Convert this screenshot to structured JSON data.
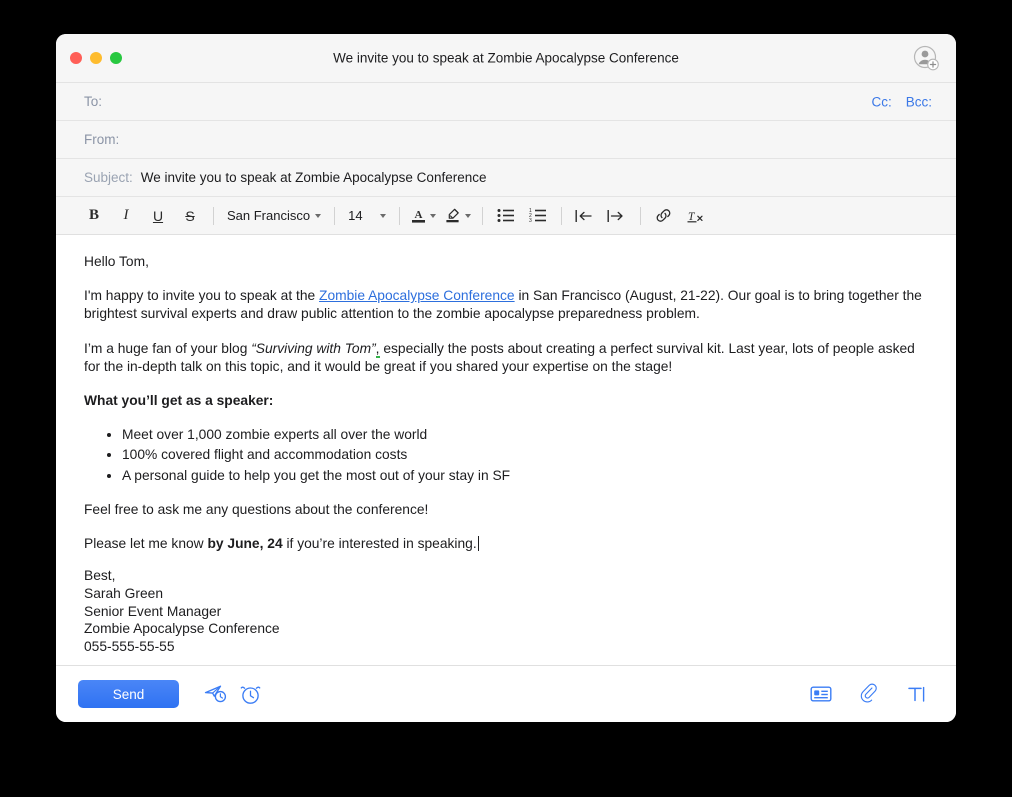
{
  "window": {
    "title": "We invite you to speak at Zombie Apocalypse Conference",
    "traffic_lights": {
      "close": "close-button",
      "minimize": "minimize-button",
      "maximize": "maximize-button"
    },
    "colors": {
      "close": "#ff5f57",
      "minimize": "#febc2e",
      "maximize": "#28c840",
      "accent": "#3b7df5",
      "link": "#2d6fdd",
      "label": "#8b94a6"
    },
    "avatar_icon": "add-contact-icon"
  },
  "fields": {
    "to": {
      "label": "To:",
      "value": "",
      "placeholder": ""
    },
    "from": {
      "label": "From:",
      "value": "",
      "placeholder": ""
    },
    "subject": {
      "label": "Subject:",
      "value": "We invite you to speak at Zombie Apocalypse Conference",
      "placeholder": ""
    },
    "cc_label": "Cc:",
    "bcc_label": "Bcc:"
  },
  "format_toolbar": {
    "bold": "B",
    "italic": "I",
    "underline": "U",
    "strikethrough": "S",
    "font_family": "San Francisco",
    "font_size": "14",
    "text_color_glyph": "A",
    "buttons": [
      "bold-button",
      "italic-button",
      "underline-button",
      "strikethrough-button",
      "font-family-select",
      "font-size-select",
      "text-color-button",
      "highlight-color-button",
      "bullet-list-button",
      "numbered-list-button",
      "outdent-button",
      "indent-button",
      "insert-link-button",
      "clear-formatting-button"
    ]
  },
  "body": {
    "greeting": "Hello Tom,",
    "para1_before_link": "I'm happy to invite you to speak at the ",
    "link_text": "Zombie Apocalypse Conference",
    "para1_after_link": " in San Francisco (August, 21-22). Our goal is to bring together the brightest survival experts and draw public attention to the zombie apocalypse preparedness problem.",
    "para2_before_italic": "I’m a huge fan of your blog ",
    "para2_italic": "“Surviving with Tom”",
    "para2_comma": ",",
    "para2_after_italic": " especially the posts about creating a perfect survival kit. Last year, lots of people asked for the in-depth talk on this topic, and it would be great if you shared your expertise on the stage!",
    "benefits_heading": "What you’ll get as a speaker:",
    "benefits": [
      "Meet over 1,000 zombie experts all over the world",
      "100% covered flight and accommodation costs",
      "A personal guide to help you get the most out of your stay in SF"
    ],
    "para3": "Feel free to ask me any questions about the conference!",
    "para4_before_bold": "Please let me know ",
    "para4_bold": "by June, 24",
    "para4_after_bold": " if you’re interested in speaking.",
    "signature": [
      "Best,",
      "Sarah Green",
      "Senior Event Manager",
      "Zombie Apocalypse Conference",
      "055-555-55-55"
    ]
  },
  "bottom_bar": {
    "send_label": "Send",
    "icons": [
      "send-later-icon",
      "reminder-icon",
      "signature-icon",
      "attachment-icon",
      "format-text-icon"
    ]
  }
}
